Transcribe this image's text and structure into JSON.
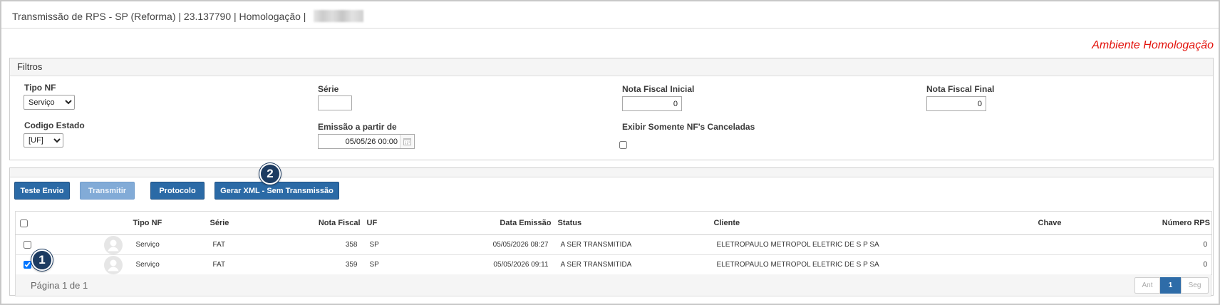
{
  "window": {
    "title": "Transmissão de RPS - SP (Reforma) | 23.137790 | Homologação |"
  },
  "environment_label": "Ambiente Homologação",
  "colors": {
    "primary_button": "#2b6aa6",
    "disabled_button": "#82abd7",
    "environment_label": "#e3120b",
    "callout": "#1c3b61",
    "active_page": "#2e6ca8"
  },
  "icons": {
    "date_picker": "calendar-icon",
    "row_avatar": "user-avatar-icon"
  },
  "filters": {
    "title": "Filtros",
    "tipo_nf": {
      "label": "Tipo NF",
      "value": "Serviço"
    },
    "serie": {
      "label": "Série",
      "value": ""
    },
    "nf_inicial": {
      "label": "Nota Fiscal Inicial",
      "value": "0"
    },
    "nf_final": {
      "label": "Nota Fiscal Final",
      "value": "0"
    },
    "codigo_estado": {
      "label": "Codigo Estado",
      "value": "[UF]"
    },
    "emissao": {
      "label": "Emissão a partir de",
      "value": "05/05/26 00:00"
    },
    "somente_canceladas": {
      "label": "Exibir Somente NF's Canceladas",
      "checked": false
    }
  },
  "actions": [
    {
      "label": "Teste Envio",
      "enabled": true
    },
    {
      "label": "Transmitir",
      "enabled": false
    },
    {
      "label": "Protocolo",
      "enabled": true
    },
    {
      "label": "Gerar XML - Sem Transmissão",
      "enabled": true
    }
  ],
  "callouts": {
    "step_1": "1",
    "step_2": "2"
  },
  "table": {
    "select_all": false,
    "columns": {
      "tipo_nf": "Tipo NF",
      "serie": "Série",
      "nota_fiscal": "Nota Fiscal",
      "uf": "UF",
      "data_emissao": "Data Emissão",
      "status": "Status",
      "cliente": "Cliente",
      "chave": "Chave",
      "numero_rps": "Número RPS"
    },
    "rows": [
      {
        "selected": false,
        "tipo_nf": "Serviço",
        "serie": "FAT",
        "nota_fiscal": "358",
        "uf": "SP",
        "data_emissao": "05/05/2026 08:27",
        "status": "A SER TRANSMITIDA",
        "cliente": "ELETROPAULO METROPOL ELETRIC DE S P SA",
        "chave": "",
        "numero_rps": "0"
      },
      {
        "selected": true,
        "tipo_nf": "Serviço",
        "serie": "FAT",
        "nota_fiscal": "359",
        "uf": "SP",
        "data_emissao": "05/05/2026 09:11",
        "status": "A SER TRANSMITIDA",
        "cliente": "ELETROPAULO METROPOL ELETRIC DE S P SA",
        "chave": "",
        "numero_rps": "0"
      }
    ]
  },
  "pagination": {
    "summary": "Página 1 de 1",
    "prev": "Ant",
    "current": "1",
    "next": "Seg"
  }
}
